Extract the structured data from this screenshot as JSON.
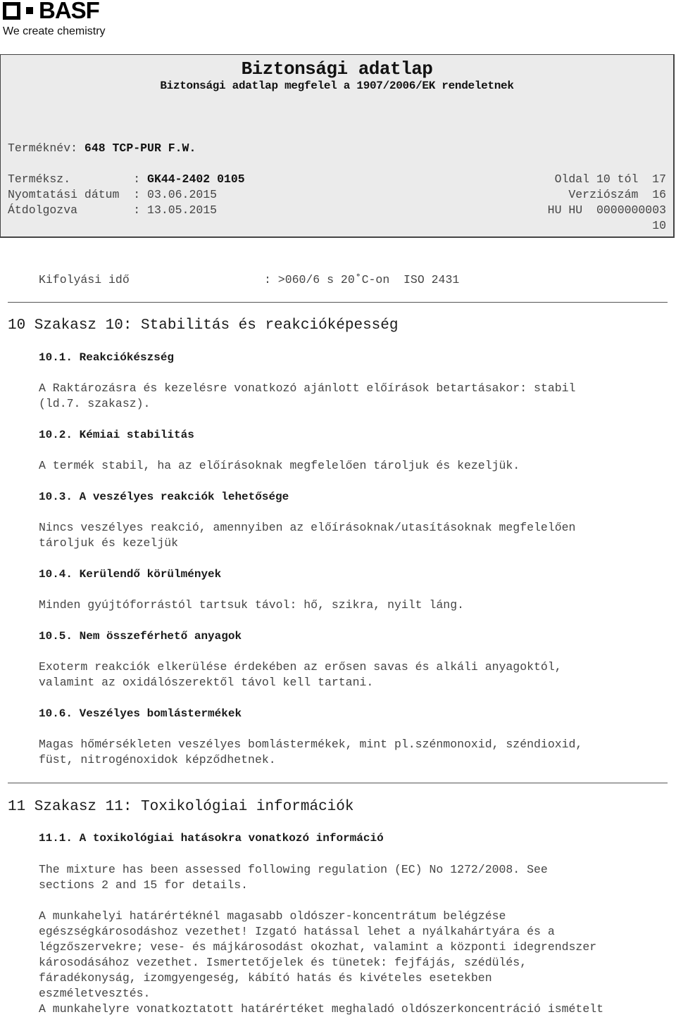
{
  "logo": {
    "brand": "BASF",
    "tagline": "We create chemistry"
  },
  "header": {
    "title": "Biztonsági adatlap",
    "subtitle": "Biztonsági adatlap megfelel a 1907/2006/EK rendeletnek",
    "product_name_label": "Terméknév: ",
    "product_name": "648 TCP-PUR F.W.",
    "product_no_label": "Terméksz.         : ",
    "product_no": "GK44-2402 0105",
    "print_date_label": "Nyomtatási dátum  : ",
    "print_date": "03.06.2015",
    "revised_label": "Átdolgozva        : ",
    "revised": "13.05.2015",
    "page_info": "Oldal 10 tól  17",
    "version": "Verziószám  16",
    "doc_code": "HU HU  0000000003",
    "doc_code_suffix": "10"
  },
  "flow_time": {
    "label": "Kifolyási idő",
    "value": ": >060/6 s 20˚C-on  ISO 2431"
  },
  "section10": {
    "title": "10 Szakasz 10: Stabilitás és reakcióképesség",
    "subsections": [
      {
        "title": "10.1. Reakciókészség",
        "text": "A Raktározásra és kezelésre vonatkozó ajánlott előírások betartásakor: stabil\n(ld.7. szakasz)."
      },
      {
        "title": "10.2. Kémiai stabilitás",
        "text": "A termék stabil, ha az előírásoknak megfelelően tároljuk és kezeljük."
      },
      {
        "title": "10.3. A veszélyes reakciók lehetősége",
        "text": "Nincs veszélyes reakció, amennyiben az előírásoknak/utasításoknak megfelelően\ntároljuk és kezeljük"
      },
      {
        "title": "10.4. Kerülendő körülmények",
        "text": "Minden gyújtóforrástól tartsuk távol: hő, szikra, nyilt láng."
      },
      {
        "title": "10.5. Nem összeférhető anyagok",
        "text": "Exoterm reakciók elkerülése érdekében az erősen savas és alkáli anyagoktól,\nvalamint az oxidálószerektől távol kell tartani."
      },
      {
        "title": "10.6. Veszélyes bomlástermékek",
        "text": "Magas hőmérsékleten veszélyes bomlástermékek, mint pl.szénmonoxid, széndioxid,\nfüst, nitrogénoxidok képződhetnek."
      }
    ]
  },
  "section11": {
    "title": "11 Szakasz 11: Toxikológiai információk",
    "subsections": [
      {
        "title": "11.1. A toxikológiai hatásokra vonatkozó információ",
        "text": "The mixture has been assessed following regulation (EC) No 1272/2008. See\nsections 2 and 15 for details."
      }
    ],
    "para2": "A munkahelyi határértéknél magasabb oldószer-koncentrátum belégzése\negészségkárosodáshoz vezethet! Izgató hatással lehet a nyálkahártyára és a\nlégzőszervekre; vese- és májkárosodást okozhat, valamint a központi idegrendszer\nkárosodásához vezethet. Ismertetőjelek és tünetek: fejfájás, szédülés,\nfáradékonyság, izomgyengeség, kábító hatás és kivételes esetekben\neszméletvesztés.\nA munkahelyre vonatkoztatott határértéket meghaladó oldószerkoncentráció ismételt"
  }
}
